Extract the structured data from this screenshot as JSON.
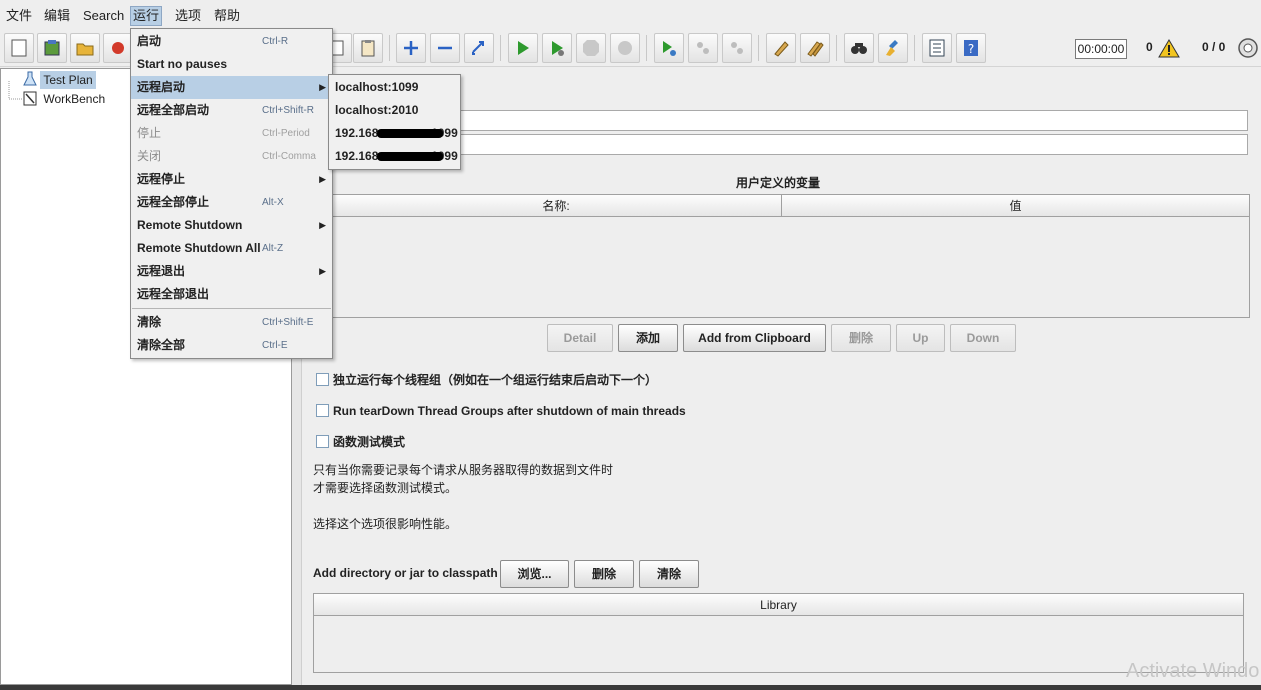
{
  "menubar": {
    "items": [
      "文件",
      "编辑",
      "Search",
      "运行",
      "选项",
      "帮助"
    ]
  },
  "toolbar": {
    "timer": "00:00:00",
    "active_threads": "0",
    "thread_ratio": "0 / 0"
  },
  "tree": {
    "items": [
      "Test Plan",
      "WorkBench"
    ]
  },
  "run_menu": {
    "items": [
      {
        "label": "启动",
        "accel": "Ctrl-R"
      },
      {
        "label": "Start no pauses",
        "accel": ""
      },
      {
        "label": "远程启动",
        "accel": ""
      },
      {
        "label": "远程全部启动",
        "accel": "Ctrl+Shift-R"
      },
      {
        "label": "停止",
        "accel": "Ctrl-Period"
      },
      {
        "label": "关闭",
        "accel": "Ctrl-Comma"
      },
      {
        "label": "远程停止",
        "accel": ""
      },
      {
        "label": "远程全部停止",
        "accel": "Alt-X"
      },
      {
        "label": "Remote Shutdown",
        "accel": ""
      },
      {
        "label": "Remote Shutdown All",
        "accel": "Alt-Z"
      },
      {
        "label": "远程退出",
        "accel": ""
      },
      {
        "label": "远程全部退出",
        "accel": ""
      },
      {
        "label": "清除",
        "accel": "Ctrl+Shift-E"
      },
      {
        "label": "清除全部",
        "accel": "Ctrl-E"
      }
    ]
  },
  "remote_submenu": {
    "items": [
      "localhost:1099",
      "localhost:2010",
      "192.168",
      "1099",
      "192.168",
      "1099"
    ]
  },
  "main": {
    "variables_title": "用户定义的变量",
    "col_name": "名称:",
    "col_value": "值",
    "buttons": {
      "detail": "Detail",
      "add": "添加",
      "add_clipboard": "Add from Clipboard",
      "delete": "删除",
      "up": "Up",
      "down": "Down"
    },
    "checkboxes": [
      "独立运行每个线程组（例如在一个组运行结束后启动下一个）",
      "Run tearDown Thread Groups after shutdown of main threads",
      "函数测试模式"
    ],
    "note_line1": "只有当你需要记录每个请求从服务器取得的数据到文件时",
    "note_line2": "才需要选择函数测试模式。",
    "note_line3": "选择这个选项很影响性能。",
    "classpath_label": "Add directory or jar to classpath",
    "classpath_buttons": {
      "browse": "浏览...",
      "delete": "删除",
      "clear": "清除"
    },
    "library_header": "Library"
  },
  "watermark": "Activate Windo"
}
